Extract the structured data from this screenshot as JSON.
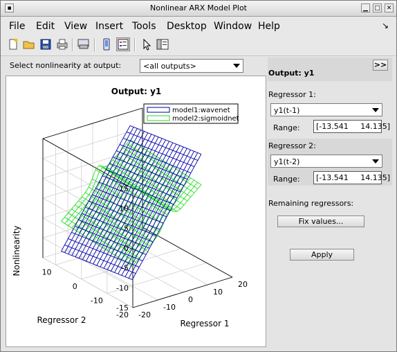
{
  "window": {
    "title": "Nonlinear ARX Model Plot"
  },
  "menu": {
    "items": [
      "File",
      "Edit",
      "View",
      "Insert",
      "Tools",
      "Desktop",
      "Window",
      "Help"
    ]
  },
  "toolbar": {
    "icons": [
      "new-file-icon",
      "open-folder-icon",
      "save-icon",
      "print-icon",
      "print-preview-icon",
      "dock-icon",
      "plot-browser-icon",
      "pointer-icon",
      "property-editor-icon"
    ]
  },
  "selector": {
    "label": "Select nonlinearity at output:",
    "value": "<all outputs>"
  },
  "plot": {
    "title": "Output: y1",
    "xlabel": "Regressor 1",
    "ylabel": "Regressor 2",
    "zlabel": "Nonlinearity",
    "legend": [
      "model1:wavenet",
      "model2:sigmoidnet"
    ],
    "legend_colors": [
      "#0000aa",
      "#22dd22"
    ],
    "z_ticks": [
      "15",
      "10",
      "5",
      "0",
      "-5",
      "-10",
      "-15"
    ],
    "reg2_ticks": [
      "10",
      "0",
      "-10",
      "-20"
    ],
    "reg1_ticks": [
      "20",
      "10",
      "0",
      "-10",
      "-20"
    ]
  },
  "chart_data": {
    "type": "surface",
    "title": "Output: y1",
    "xlabel": "Regressor 1",
    "ylabel": "Regressor 2",
    "zlabel": "Nonlinearity",
    "xlim": [
      -20,
      20
    ],
    "ylim": [
      -20,
      15
    ],
    "zlim": [
      -15,
      15
    ],
    "series": [
      {
        "name": "model1:wavenet"
      },
      {
        "name": "model2:sigmoidnet"
      }
    ]
  },
  "side": {
    "collapse_button": ">>",
    "output_title": "Output: y1",
    "regressor1": {
      "label": "Regressor 1:",
      "value": "y1(t-1)",
      "range_label": "Range:",
      "range_value": "[-13.541     14.135]"
    },
    "regressor2": {
      "label": "Regressor 2:",
      "value": "y1(t-2)",
      "range_label": "Range:",
      "range_value": "[-13.541     14.135]"
    },
    "remaining_label": "Remaining regressors:",
    "fix_button": "Fix values...",
    "apply_button": "Apply"
  }
}
